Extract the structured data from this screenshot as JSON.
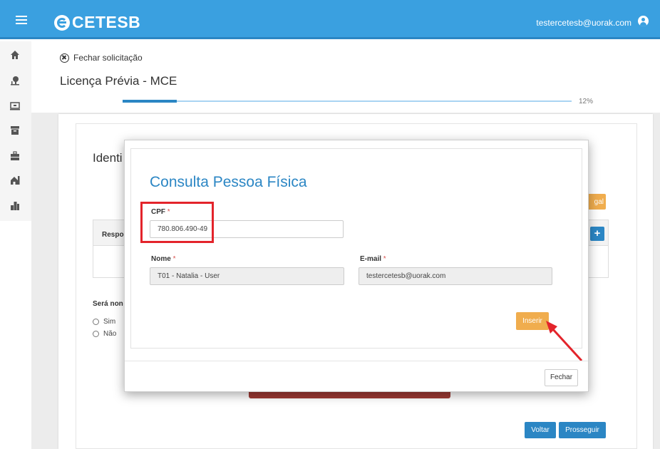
{
  "header": {
    "brand": "CETESB",
    "user_email": "testercetesb@uorak.com",
    "menu_icon": "hamburger-menu-icon",
    "user_icon": "user-circle-icon",
    "brand_color": "#3aa0e0"
  },
  "sidebar": {
    "items": [
      {
        "icon": "home-icon"
      },
      {
        "icon": "tree-icon"
      },
      {
        "icon": "monitor-icon"
      },
      {
        "icon": "archive-icon"
      },
      {
        "icon": "briefcase-icon"
      },
      {
        "icon": "house-building-icon"
      },
      {
        "icon": "city-icon"
      }
    ]
  },
  "page": {
    "close_label": "Fechar solicitação",
    "title": "Licença Prévia - MCE",
    "progress_value": 0.12,
    "progress_label": "12%"
  },
  "background_form": {
    "section_title": "Identi",
    "legal_button": "gal",
    "table_header": "Respo",
    "add_button": "+",
    "nominated_label": "Será non",
    "radio_options": [
      "Sim",
      "Não"
    ],
    "back_button": "Voltar",
    "next_button": "Prosseguir"
  },
  "modal": {
    "title": "Consulta Pessoa Física",
    "cpf_label": "CPF",
    "cpf_value": "780.806.490-49",
    "name_label": "Nome",
    "name_value": "T01 - Natalia - User",
    "email_label": "E-mail",
    "email_value": "testercetesb@uorak.com",
    "required_mark": "*",
    "insert_button": "Inserir",
    "close_button": "Fechar"
  },
  "colors": {
    "primary": "#2b86c4",
    "warning": "#f0ad4e",
    "annotation_red": "#e3242b"
  }
}
